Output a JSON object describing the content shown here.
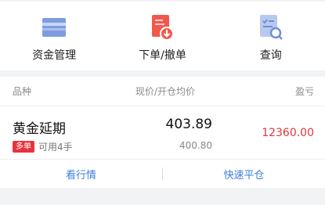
{
  "actions": [
    {
      "label": "资金管理",
      "icon": "card-icon"
    },
    {
      "label": "下单/撤单",
      "icon": "order-document-icon"
    },
    {
      "label": "查询",
      "icon": "search-document-icon"
    }
  ],
  "colors": {
    "accent_blue": "#3f7fd9",
    "icon_blue": "#6e8fd6",
    "icon_red": "#f2594c",
    "profit_red": "#e0353e"
  },
  "table": {
    "headers": {
      "name": "品种",
      "price": "现价/开仓均价",
      "pl": "盈亏"
    },
    "rows": [
      {
        "name": "黄金延期",
        "badge": "多单",
        "available": "可用4手",
        "price": "403.89",
        "avg_price": "400.80",
        "profit_loss": "12360.00"
      }
    ]
  },
  "footer": {
    "left": "看行情",
    "right": "快速平仓"
  }
}
